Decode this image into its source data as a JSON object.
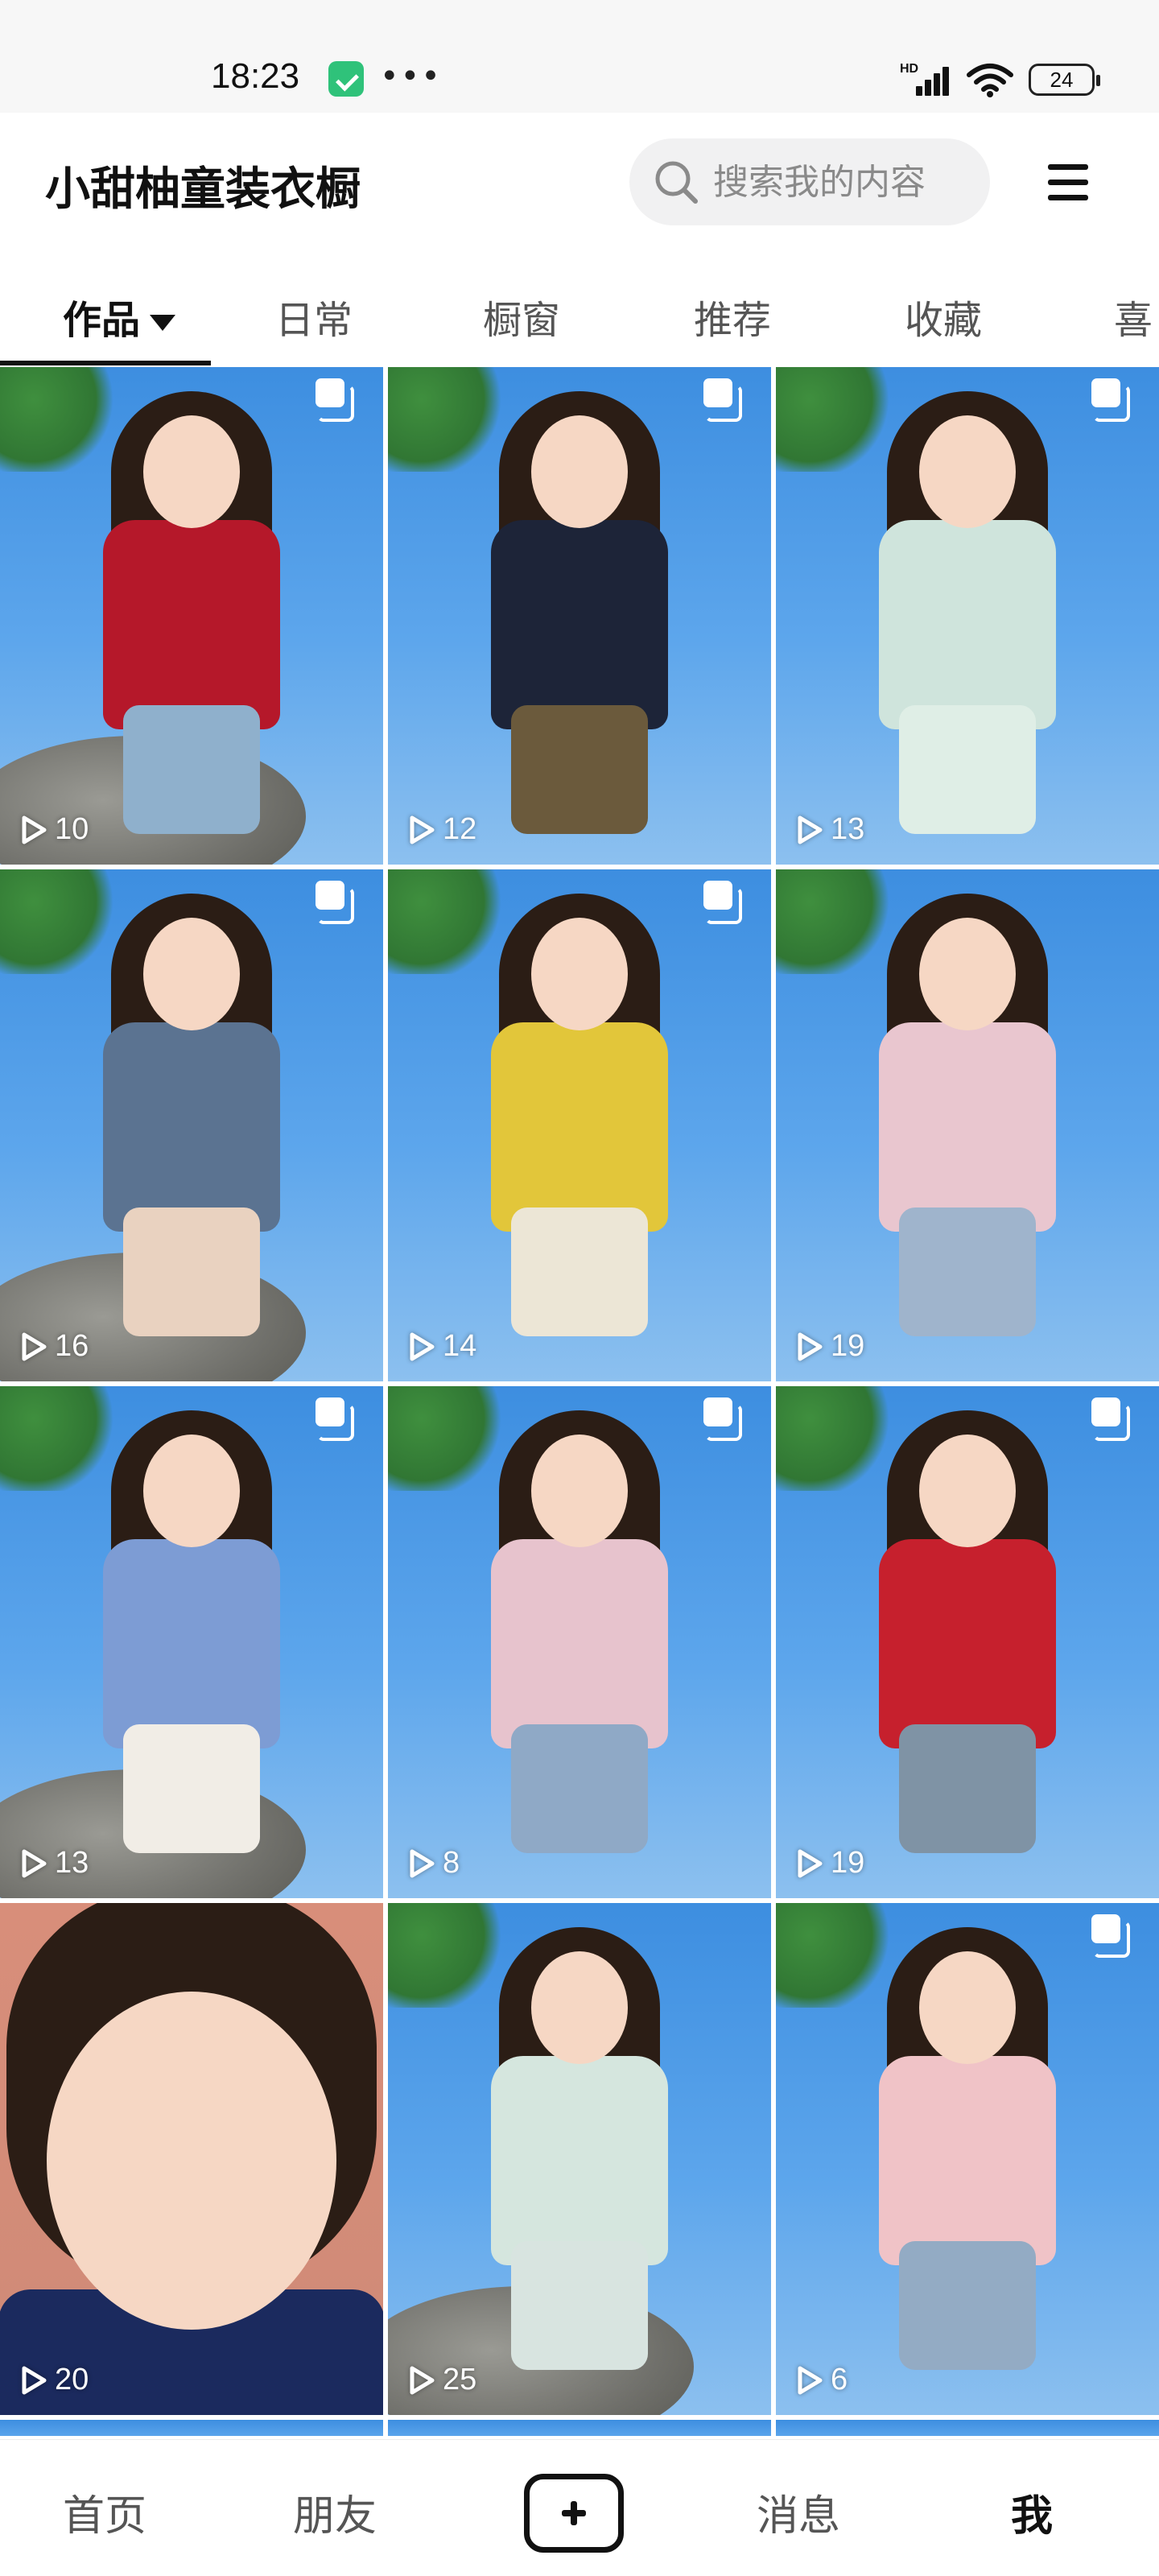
{
  "status_bar": {
    "time": "18:23",
    "network": "HD",
    "battery": "24",
    "icons": [
      "app-notification-icon",
      "more-dots-icon",
      "signal-icon",
      "wifi-icon",
      "battery-icon"
    ]
  },
  "header": {
    "title": "小甜柚童装衣橱",
    "search_placeholder": "搜索我的内容",
    "menu_icon": "hamburger-menu-icon"
  },
  "tabs": [
    {
      "label": "作品",
      "active": true
    },
    {
      "label": "日常",
      "active": false
    },
    {
      "label": "橱窗",
      "active": false
    },
    {
      "label": "推荐",
      "active": false
    },
    {
      "label": "收藏",
      "active": false
    },
    {
      "label": "喜",
      "active": false
    }
  ],
  "grid": {
    "items": [
      {
        "plays": "10",
        "multi_image": true,
        "outfit": "red-tee-jeans",
        "colors": [
          "#b5182a",
          "#8fb0cc"
        ]
      },
      {
        "plays": "12",
        "multi_image": true,
        "outfit": "black-top-khaki-pants",
        "colors": [
          "#1d2438",
          "#6b5a3c"
        ]
      },
      {
        "plays": "13",
        "multi_image": true,
        "outfit": "mint-tulle-dress",
        "colors": [
          "#cfe4dc",
          "#dfeee6"
        ]
      },
      {
        "plays": "16",
        "multi_image": true,
        "outfit": "denim-overall-dress",
        "colors": [
          "#5b7391",
          "#e9d2c0"
        ]
      },
      {
        "plays": "14",
        "multi_image": true,
        "outfit": "yellow-vest-cream-pants",
        "colors": [
          "#e2c63a",
          "#ece6d6"
        ]
      },
      {
        "plays": "19",
        "multi_image": false,
        "outfit": "pink-pinafore",
        "colors": [
          "#e9c6cf",
          "#9fb4cc"
        ]
      },
      {
        "plays": "13",
        "multi_image": true,
        "outfit": "blue-gingham-dress",
        "colors": [
          "#7d9cd4",
          "#f1ede6"
        ]
      },
      {
        "plays": "8",
        "multi_image": true,
        "outfit": "pink-pinafore-jeans",
        "colors": [
          "#e7c3cd",
          "#8fa9c6"
        ]
      },
      {
        "plays": "19",
        "multi_image": true,
        "outfit": "red-top-denim-overalls",
        "colors": [
          "#c6202d",
          "#7f93a5"
        ]
      },
      {
        "plays": "20",
        "multi_image": false,
        "outfit": "closeup-navy-top",
        "closeup": true,
        "colors": [
          "#1b2a5e",
          "#1b2a5e"
        ]
      },
      {
        "plays": "25",
        "multi_image": false,
        "outfit": "mint-top-pants",
        "colors": [
          "#d5e6de",
          "#d8e4e0"
        ]
      },
      {
        "plays": "6",
        "multi_image": true,
        "outfit": "pink-tee-striped-sleeves",
        "colors": [
          "#f0c3c7",
          "#93abc4"
        ]
      }
    ]
  },
  "bottom_nav": {
    "items": [
      {
        "label": "首页",
        "active": false
      },
      {
        "label": "朋友",
        "active": false
      },
      {
        "label": "消息",
        "active": false
      },
      {
        "label": "我",
        "active": true
      }
    ],
    "create_icon": "plus-box-icon"
  }
}
